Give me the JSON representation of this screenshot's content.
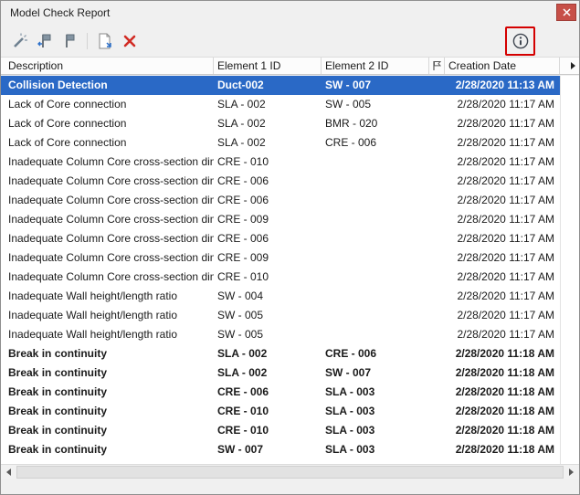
{
  "window": {
    "title": "Model Check Report"
  },
  "toolbar": {
    "icon_names": [
      "run-checks-icon",
      "flag-with-arrow-icon",
      "flag-icon",
      "new-report-icon",
      "delete-icon",
      "info-icon"
    ]
  },
  "table": {
    "headers": {
      "description": "Description",
      "element1": "Element 1 ID",
      "element2": "Element 2 ID",
      "flag_icon": "flag-outline-icon",
      "date": "Creation Date"
    },
    "rows": [
      {
        "description": "Collision Detection",
        "element1": "Duct-002",
        "element2": "SW - 007",
        "date": "2/28/2020 11:13 AM",
        "selected": true,
        "bold": true
      },
      {
        "description": "Lack of Core connection",
        "element1": "SLA - 002",
        "element2": "SW - 005",
        "date": "2/28/2020 11:17 AM"
      },
      {
        "description": "Lack of Core connection",
        "element1": "SLA - 002",
        "element2": "BMR - 020",
        "date": "2/28/2020 11:17 AM"
      },
      {
        "description": "Lack of Core connection",
        "element1": "SLA - 002",
        "element2": "CRE - 006",
        "date": "2/28/2020 11:17 AM"
      },
      {
        "description": "Inadequate Column Core cross-section dim...",
        "element1": "CRE - 010",
        "element2": "",
        "date": "2/28/2020 11:17 AM"
      },
      {
        "description": "Inadequate Column Core cross-section dim...",
        "element1": "CRE - 006",
        "element2": "",
        "date": "2/28/2020 11:17 AM"
      },
      {
        "description": "Inadequate Column Core cross-section dim...",
        "element1": "CRE - 006",
        "element2": "",
        "date": "2/28/2020 11:17 AM"
      },
      {
        "description": "Inadequate Column Core cross-section dim...",
        "element1": "CRE - 009",
        "element2": "",
        "date": "2/28/2020 11:17 AM"
      },
      {
        "description": "Inadequate Column Core cross-section dim...",
        "element1": "CRE - 006",
        "element2": "",
        "date": "2/28/2020 11:17 AM"
      },
      {
        "description": "Inadequate Column Core cross-section dim...",
        "element1": "CRE - 009",
        "element2": "",
        "date": "2/28/2020 11:17 AM"
      },
      {
        "description": "Inadequate Column Core cross-section dim...",
        "element1": "CRE - 010",
        "element2": "",
        "date": "2/28/2020 11:17 AM"
      },
      {
        "description": "Inadequate Wall height/length ratio",
        "element1": "SW - 004",
        "element2": "",
        "date": "2/28/2020 11:17 AM"
      },
      {
        "description": "Inadequate Wall height/length ratio",
        "element1": "SW - 005",
        "element2": "",
        "date": "2/28/2020 11:17 AM"
      },
      {
        "description": "Inadequate Wall height/length ratio",
        "element1": "SW - 005",
        "element2": "",
        "date": "2/28/2020 11:17 AM"
      },
      {
        "description": "Break in continuity",
        "element1": "SLA - 002",
        "element2": "CRE - 006",
        "date": "2/28/2020 11:18 AM",
        "bold": true
      },
      {
        "description": "Break in continuity",
        "element1": "SLA - 002",
        "element2": "SW - 007",
        "date": "2/28/2020 11:18 AM",
        "bold": true
      },
      {
        "description": "Break in continuity",
        "element1": "CRE - 006",
        "element2": "SLA - 003",
        "date": "2/28/2020 11:18 AM",
        "bold": true
      },
      {
        "description": "Break in continuity",
        "element1": "CRE - 010",
        "element2": "SLA - 003",
        "date": "2/28/2020 11:18 AM",
        "bold": true
      },
      {
        "description": "Break in continuity",
        "element1": "CRE - 010",
        "element2": "SLA - 003",
        "date": "2/28/2020 11:18 AM",
        "bold": true
      },
      {
        "description": "Break in continuity",
        "element1": "SW - 007",
        "element2": "SLA - 003",
        "date": "2/28/2020 11:18 AM",
        "bold": true
      }
    ]
  },
  "scrollbar": {
    "icon_names": [
      "scroll-left-icon",
      "scroll-right-icon",
      "header-scroll-right-icon"
    ]
  },
  "colors": {
    "selection_blue": "#2a69c6",
    "annotation_red": "#d40000",
    "delete_red": "#d12b24",
    "close_button_red": "#c75048",
    "titlebar_bg": "#f0f0f0",
    "row_bg": "#ffffff"
  }
}
